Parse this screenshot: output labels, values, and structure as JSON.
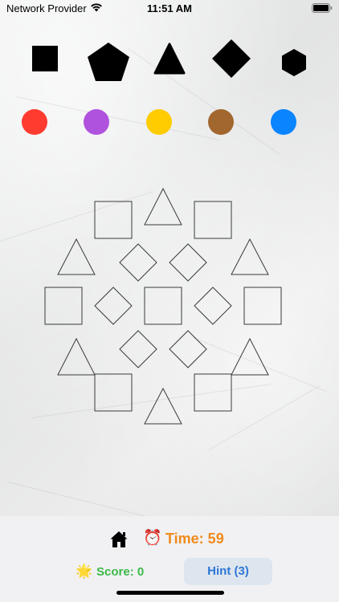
{
  "status_bar": {
    "carrier": "Network Provider",
    "time": "11:51 AM",
    "icons": [
      "wifi-icon",
      "battery-icon"
    ]
  },
  "palette": {
    "shapes": [
      {
        "name": "square",
        "color": "#000000"
      },
      {
        "name": "pentagon",
        "color": "#000000"
      },
      {
        "name": "triangle",
        "color": "#000000"
      },
      {
        "name": "diamond",
        "color": "#000000"
      },
      {
        "name": "hexagon",
        "color": "#000000"
      }
    ],
    "colors": [
      {
        "name": "red",
        "hex": "#ff3b30"
      },
      {
        "name": "purple",
        "hex": "#af52de"
      },
      {
        "name": "yellow",
        "hex": "#ffcc00"
      },
      {
        "name": "brown",
        "hex": "#a2672f"
      },
      {
        "name": "blue",
        "hex": "#0a84ff"
      }
    ]
  },
  "board": {
    "outline_color": "#3a3a3a",
    "pieces": [
      "square",
      "triangle",
      "square",
      "triangle",
      "diamond",
      "diamond",
      "triangle",
      "square",
      "diamond",
      "square",
      "diamond",
      "square",
      "diamond",
      "diamond",
      "triangle",
      "triangle",
      "square",
      "square",
      "triangle"
    ]
  },
  "footer": {
    "home_icon": "home-icon",
    "alarm_icon": "⏰",
    "timer_text": "Time: 59",
    "star_icon": "🌟",
    "score_text": "Score: 0",
    "hint_label": "Hint (3)"
  }
}
